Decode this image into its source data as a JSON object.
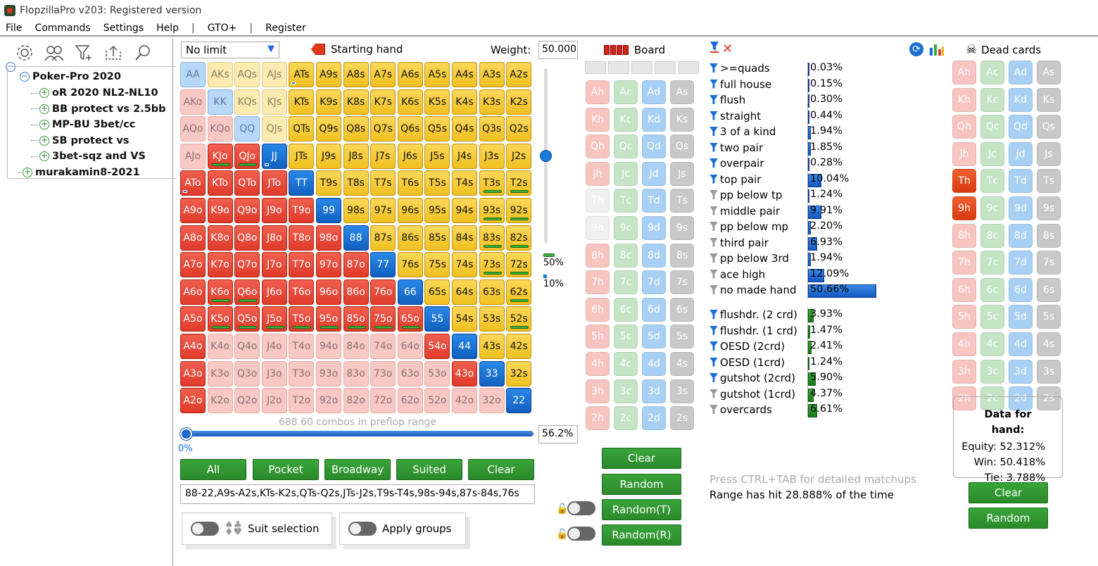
{
  "window": {
    "title": "FlopzillaPro v203: Registered version"
  },
  "menu": [
    "File",
    "Commands",
    "Settings",
    "Help",
    "|",
    "GTO+",
    "|",
    "Register"
  ],
  "tree": {
    "root": "Poker-Pro 2020",
    "children": [
      "oR 2020 NL2-NL10",
      "BB protect vs 2.5bb",
      "MP-BU 3bet/cc",
      "SB protect vs",
      "3bet-sqz and VS"
    ],
    "second_root": "murakamin8-2021"
  },
  "toolbar_icons": [
    "gear-icon",
    "users-icon",
    "filter-add-icon",
    "share-icon",
    "search-icon"
  ],
  "range": {
    "game_type": "No limit",
    "starting_hand_label": "Starting hand",
    "weight_label": "Weight:",
    "weight_value": "50.000",
    "legend_50": "50%",
    "legend_10": "10%",
    "combos_text": "688.60 combos in preflop range",
    "slider_value": "56.2%",
    "slider_min": "0%",
    "range_text": "88-22,A9s-A2s,KTs-K2s,QTs-Q2s,JTs-J2s,T9s-T4s,98s-94s,87s-84s,76s",
    "buttons": {
      "all": "All",
      "pocket": "Pocket",
      "broadway": "Broadway",
      "suited": "Suited",
      "clear": "Clear"
    },
    "suit_selection": "Suit selection",
    "apply_groups": "Apply groups"
  },
  "hands": [
    [
      "AA",
      "AKs",
      "AQs",
      "AJs",
      "ATs",
      "A9s",
      "A8s",
      "A7s",
      "A6s",
      "A5s",
      "A4s",
      "A3s",
      "A2s"
    ],
    [
      "AKo",
      "KK",
      "KQs",
      "KJs",
      "KTs",
      "K9s",
      "K8s",
      "K7s",
      "K6s",
      "K5s",
      "K4s",
      "K3s",
      "K2s"
    ],
    [
      "AQo",
      "KQo",
      "QQ",
      "QJs",
      "QTs",
      "Q9s",
      "Q8s",
      "Q7s",
      "Q6s",
      "Q5s",
      "Q4s",
      "Q3s",
      "Q2s"
    ],
    [
      "AJo",
      "KJo",
      "QJo",
      "JJ",
      "JTs",
      "J9s",
      "J8s",
      "J7s",
      "J6s",
      "J5s",
      "J4s",
      "J3s",
      "J2s"
    ],
    [
      "ATo",
      "KTo",
      "QTo",
      "JTo",
      "TT",
      "T9s",
      "T8s",
      "T7s",
      "T6s",
      "T5s",
      "T4s",
      "T3s",
      "T2s"
    ],
    [
      "A9o",
      "K9o",
      "Q9o",
      "J9o",
      "T9o",
      "99",
      "98s",
      "97s",
      "96s",
      "95s",
      "94s",
      "93s",
      "92s"
    ],
    [
      "A8o",
      "K8o",
      "Q8o",
      "J8o",
      "T8o",
      "98o",
      "88",
      "87s",
      "86s",
      "85s",
      "84s",
      "83s",
      "82s"
    ],
    [
      "A7o",
      "K7o",
      "Q7o",
      "J7o",
      "T7o",
      "97o",
      "87o",
      "77",
      "76s",
      "75s",
      "74s",
      "73s",
      "72s"
    ],
    [
      "A6o",
      "K6o",
      "Q6o",
      "J6o",
      "T6o",
      "96o",
      "86o",
      "76o",
      "66",
      "65s",
      "64s",
      "63s",
      "62s"
    ],
    [
      "A5o",
      "K5o",
      "Q5o",
      "J5o",
      "T5o",
      "95o",
      "85o",
      "75o",
      "65o",
      "55",
      "54s",
      "53s",
      "52s"
    ],
    [
      "A4o",
      "K4o",
      "Q4o",
      "J4o",
      "T4o",
      "94o",
      "84o",
      "74o",
      "64o",
      "54o",
      "44",
      "43s",
      "42s"
    ],
    [
      "A3o",
      "K3o",
      "Q3o",
      "J3o",
      "T3o",
      "93o",
      "83o",
      "73o",
      "63o",
      "53o",
      "43o",
      "33",
      "32s"
    ],
    [
      "A2o",
      "K2o",
      "Q2o",
      "J2o",
      "T2o",
      "92o",
      "82o",
      "72o",
      "62o",
      "52o",
      "42o",
      "32o",
      "22"
    ]
  ],
  "hand_states": [
    [
      "lb",
      "ly",
      "ly",
      "ly",
      "y",
      "y",
      "y",
      "y",
      "y",
      "y",
      "y",
      "y",
      "y"
    ],
    [
      "p",
      "lb",
      "ly",
      "ly",
      "y",
      "y",
      "y",
      "y",
      "y",
      "y",
      "y",
      "y",
      "y"
    ],
    [
      "p",
      "p",
      "lb",
      "ly",
      "y",
      "y",
      "y",
      "y",
      "y",
      "y",
      "y",
      "y",
      "y"
    ],
    [
      "p",
      "r",
      "r",
      "b",
      "y",
      "y",
      "y",
      "y",
      "y",
      "y",
      "y",
      "y",
      "y"
    ],
    [
      "r",
      "r",
      "r",
      "r",
      "b",
      "y",
      "y",
      "y",
      "y",
      "y",
      "y",
      "y",
      "y"
    ],
    [
      "r",
      "r",
      "r",
      "r",
      "r",
      "b",
      "y",
      "y",
      "y",
      "y",
      "y",
      "y",
      "y"
    ],
    [
      "r",
      "r",
      "r",
      "r",
      "r",
      "r",
      "b",
      "y",
      "y",
      "y",
      "y",
      "y",
      "y"
    ],
    [
      "r",
      "r",
      "r",
      "r",
      "r",
      "r",
      "r",
      "b",
      "y",
      "y",
      "y",
      "y",
      "y"
    ],
    [
      "r",
      "r",
      "r",
      "r",
      "r",
      "r",
      "r",
      "r",
      "b",
      "y",
      "y",
      "y",
      "y"
    ],
    [
      "r",
      "r",
      "r",
      "r",
      "r",
      "r",
      "r",
      "r",
      "r",
      "b",
      "y",
      "y",
      "y"
    ],
    [
      "r",
      "p",
      "p",
      "p",
      "p",
      "p",
      "p",
      "p",
      "p",
      "r",
      "b",
      "y",
      "y"
    ],
    [
      "r",
      "p",
      "p",
      "p",
      "p",
      "p",
      "p",
      "p",
      "p",
      "p",
      "r",
      "b",
      "y"
    ],
    [
      "r",
      "p",
      "p",
      "p",
      "p",
      "p",
      "p",
      "p",
      "p",
      "p",
      "p",
      "p",
      "b"
    ]
  ],
  "hand_weight_marks": {
    "green": [
      "KJo",
      "QJo",
      "T3s",
      "T2s",
      "93s",
      "92s",
      "83s",
      "82s",
      "73s",
      "72s",
      "K6o",
      "Q6o",
      "62s",
      "K5o",
      "Q5o",
      "J5o",
      "T5o",
      "95o",
      "85o",
      "75o",
      "65o",
      "52s"
    ],
    "blue": [
      "ATs",
      "JJ",
      "ATo"
    ]
  },
  "board": {
    "title": "Board",
    "ranks": [
      "A",
      "K",
      "Q",
      "J",
      "T",
      "9",
      "8",
      "7",
      "6",
      "5",
      "4",
      "3",
      "2"
    ],
    "suits": [
      "h",
      "c",
      "d",
      "s"
    ],
    "used": [
      "Th",
      "9h"
    ],
    "buttons": {
      "clear": "Clear",
      "random": "Random",
      "random_t": "Random(T)",
      "random_r": "Random(R)"
    }
  },
  "dead": {
    "title": "Dead cards",
    "marked": [
      "Th",
      "9h"
    ],
    "buttons": {
      "clear": "Clear",
      "random": "Random"
    }
  },
  "stats": [
    {
      "name": ">=quads",
      "value": "0.03%",
      "pct": 0.03,
      "filter": "blue"
    },
    {
      "name": "full house",
      "value": "0.15%",
      "pct": 0.15,
      "filter": "blue"
    },
    {
      "name": "flush",
      "value": "0.30%",
      "pct": 0.3,
      "filter": "blue"
    },
    {
      "name": "straight",
      "value": "0.44%",
      "pct": 0.44,
      "filter": "blue"
    },
    {
      "name": "3 of a kind",
      "value": "1.94%",
      "pct": 1.94,
      "filter": "blue"
    },
    {
      "name": "two pair",
      "value": "1.85%",
      "pct": 1.85,
      "filter": "blue"
    },
    {
      "name": "overpair",
      "value": "0.28%",
      "pct": 0.28,
      "filter": "blue"
    },
    {
      "name": "top pair",
      "value": "10.04%",
      "pct": 10.04,
      "filter": "blue"
    },
    {
      "name": "pp below tp",
      "value": "1.24%",
      "pct": 1.24,
      "filter": "gray"
    },
    {
      "name": "middle pair",
      "value": "9.91%",
      "pct": 9.91,
      "filter": "gray"
    },
    {
      "name": "pp below mp",
      "value": "2.20%",
      "pct": 2.2,
      "filter": "gray"
    },
    {
      "name": "third pair",
      "value": "6.93%",
      "pct": 6.93,
      "filter": "gray"
    },
    {
      "name": "pp below 3rd",
      "value": "1.94%",
      "pct": 1.94,
      "filter": "gray"
    },
    {
      "name": "ace high",
      "value": "12.09%",
      "pct": 12.09,
      "filter": "gray"
    },
    {
      "name": "no made hand",
      "value": "50.66%",
      "pct": 50.66,
      "filter": "gray"
    }
  ],
  "draws": [
    {
      "name": "flushdr. (2 crd)",
      "value": "3.93%",
      "pct": 3.93,
      "filter": "blue"
    },
    {
      "name": "flushdr. (1 crd)",
      "value": "1.47%",
      "pct": 1.47,
      "filter": "blue"
    },
    {
      "name": "OESD (2crd)",
      "value": "2.41%",
      "pct": 2.41,
      "filter": "blue"
    },
    {
      "name": "OESD (1crd)",
      "value": "1.24%",
      "pct": 1.24,
      "filter": "blue"
    },
    {
      "name": "gutshot (2crd)",
      "value": "5.90%",
      "pct": 5.9,
      "filter": "blue"
    },
    {
      "name": "gutshot (1crd)",
      "value": "4.37%",
      "pct": 4.37,
      "filter": "gray"
    },
    {
      "name": "overcards",
      "value": "6.61%",
      "pct": 6.61,
      "filter": "gray"
    }
  ],
  "notes": {
    "ctrl_tab": "Press CTRL+TAB for detailed matchups",
    "hit": "Range has hit 28.888% of the time"
  },
  "hand_data": {
    "title": "Data for hand:",
    "equity": "Equity: 52.312%",
    "win": "Win: 50.418%",
    "tie": "Tie: 3.788%"
  },
  "colors": {
    "green_button": "#2a8a2a",
    "red": "#e03a2a",
    "blue": "#1a6fd0",
    "yellow": "#f0c020"
  }
}
